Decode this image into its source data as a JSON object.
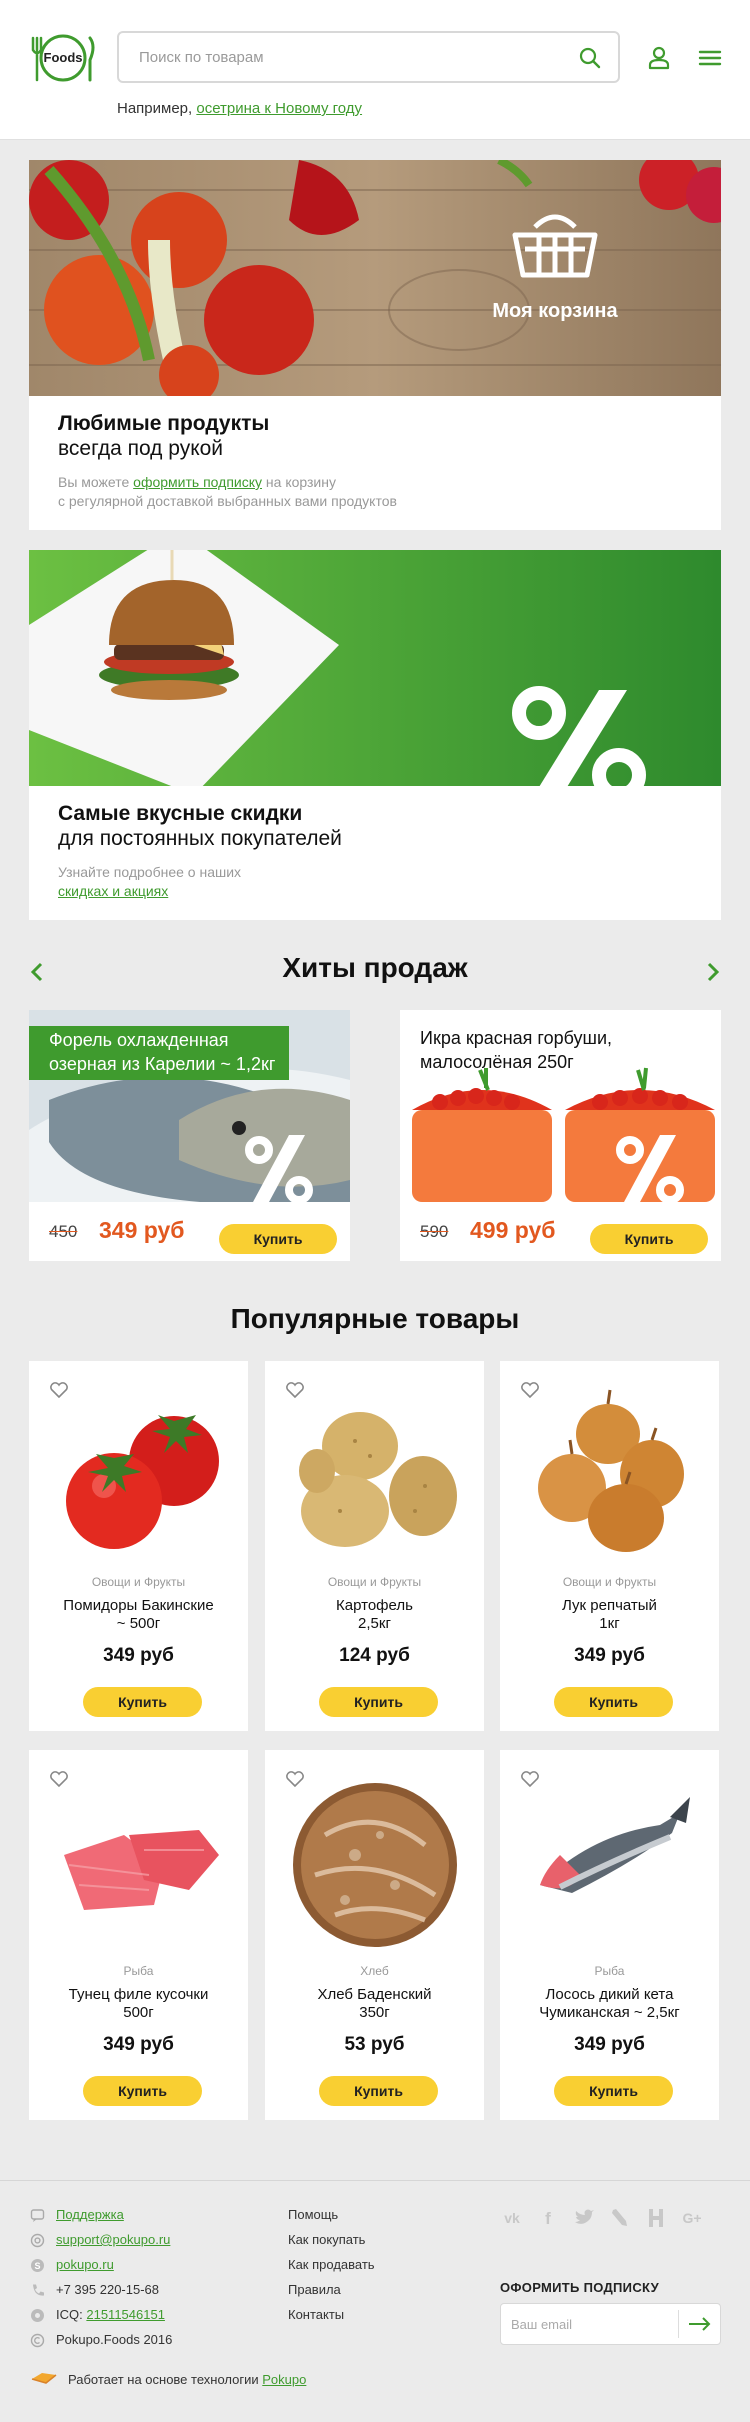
{
  "header": {
    "logo_text": "Foods",
    "search_placeholder": "Поиск по товарам",
    "example_prefix": "Например,",
    "example_link": "осетрина к Новому году"
  },
  "promo1": {
    "banner_label": "Моя корзина",
    "title": "Любимые продукты",
    "subtitle": "всегда под рукой",
    "text_before": "Вы можете",
    "link": "оформить подписку",
    "text_after": "на корзину",
    "text_line2": "с регулярной доставкой выбранных вами продуктов"
  },
  "promo2": {
    "title": "Самые вкусные скидки",
    "subtitle": "для постоянных покупателей",
    "text_line1": "Узнайте подробнее о наших",
    "link": "скидках и акциях"
  },
  "hits": {
    "title": "Хиты продаж",
    "items": [
      {
        "title_line1": "Форель охлажденная",
        "title_line2": "озерная из Карелии ~ 1,2кг",
        "old_price": "450",
        "price": "349 руб",
        "buy": "Купить"
      },
      {
        "title_line1": "Икра красная горбуши,",
        "title_line2": "малосолёная 250г",
        "old_price": "590",
        "price": "499 руб",
        "buy": "Купить"
      }
    ]
  },
  "popular": {
    "title": "Популярные товары",
    "items": [
      {
        "category": "Овощи и Фрукты",
        "name_line1": "Помидоры Бакинские",
        "name_line2": "~ 500г",
        "price": "349 руб",
        "buy": "Купить"
      },
      {
        "category": "Овощи и Фрукты",
        "name_line1": "Картофель",
        "name_line2": "2,5кг",
        "price": "124 руб",
        "buy": "Купить"
      },
      {
        "category": "Овощи и Фрукты",
        "name_line1": "Лук репчатый",
        "name_line2": "1кг",
        "price": "349 руб",
        "buy": "Купить"
      },
      {
        "category": "Рыба",
        "name_line1": "Тунец филе кусочки",
        "name_line2": "500г",
        "price": "349 руб",
        "buy": "Купить"
      },
      {
        "category": "Хлеб",
        "name_line1": "Хлеб Баденский",
        "name_line2": "350г",
        "price": "53 руб",
        "buy": "Купить"
      },
      {
        "category": "Рыба",
        "name_line1": "Лосось дикий кета",
        "name_line2": "Чумиканская ~ 2,5кг",
        "price": "349 руб",
        "buy": "Купить"
      }
    ]
  },
  "footer": {
    "contacts": {
      "support": "Поддержка",
      "email": "support@pokupo.ru",
      "skype": "pokupo.ru",
      "phone": "+7 395 220-15-68",
      "icq_label": "ICQ:",
      "icq": "21511546151",
      "copyright": "Pokupo.Foods 2016"
    },
    "menu": [
      "Помощь",
      "Как покупать",
      "Как продавать",
      "Правила",
      "Контакты"
    ],
    "social": [
      "vk-icon",
      "facebook-icon",
      "twitter-icon",
      "livejournal-icon",
      "habr-icon",
      "google-plus-icon"
    ],
    "subscribe_title": "ОФОРМИТЬ ПОДПИСКУ",
    "subscribe_placeholder": "Ваш email",
    "tech_text": "Работает на основе технологии",
    "tech_link": "Pokupo"
  },
  "colors": {
    "brand_green": "#3f9b2e",
    "button_yellow": "#f9cf32",
    "sale_orange": "#e2581f",
    "background": "#ebebeb"
  }
}
